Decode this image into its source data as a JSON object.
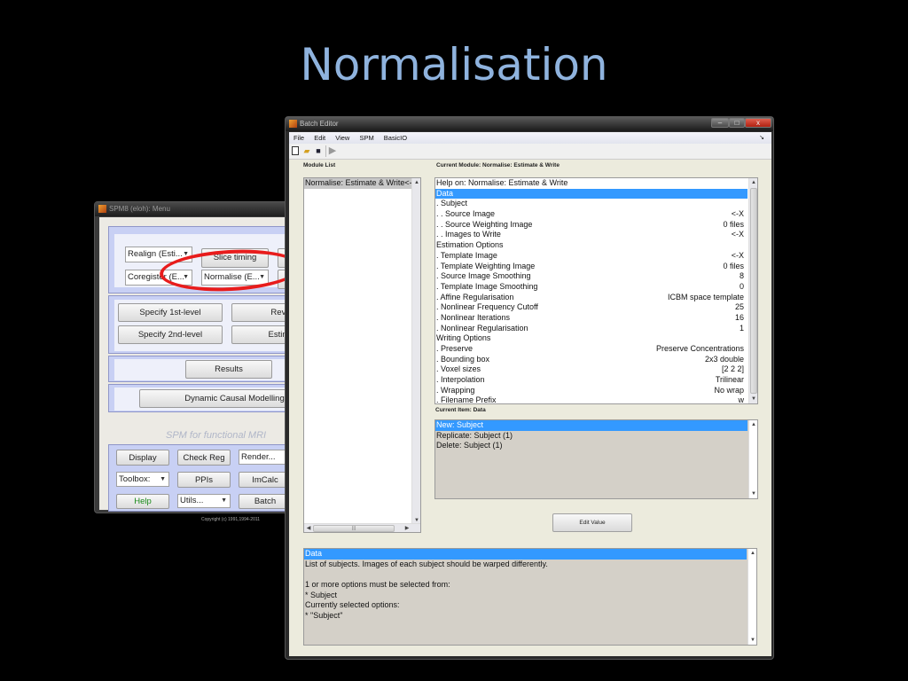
{
  "slide": {
    "title": "Normalisation"
  },
  "spm_menu": {
    "window_title": "SPM8 (eloh): Menu",
    "spatial": {
      "realign": "Realign (Esti...",
      "slice_timing": "Slice timing",
      "coregister": "Coregister (E...",
      "normalise": "Normalise (E..."
    },
    "model": {
      "specify_1st": "Specify 1st-level",
      "review": "Review",
      "specify_2nd": "Specify 2nd-level",
      "estimate": "Estimate"
    },
    "results": "Results",
    "dcm": "Dynamic Causal Modelling",
    "caption": "SPM for functional MRI",
    "tools": {
      "display": "Display",
      "check_reg": "Check Reg",
      "render": "Render...",
      "toolbox": "Toolbox:",
      "ppis": "PPIs",
      "imcalc": "ImCalc",
      "help": "Help",
      "utils": "Utils...",
      "batch": "Batch"
    },
    "copyright": "Copyright (c) 1991,1994-2011"
  },
  "annotation": {
    "color": "#e81c1c",
    "target": "Normalise (E..."
  },
  "batch_editor": {
    "window_title": "Batch Editor",
    "window_controls": {
      "minimize": "–",
      "maximize": "□",
      "close": "x"
    },
    "menu": [
      "File",
      "Edit",
      "View",
      "SPM",
      "BasicIO"
    ],
    "toolbar": [
      "new-file",
      "open-folder",
      "save",
      "run"
    ],
    "module_list_label": "Module List",
    "module_list": [
      "Normalise: Estimate & Write<-"
    ],
    "current_module_label": "Current Module: Normalise: Estimate & Write",
    "module_rows": [
      {
        "label": "Help on: Normalise: Estimate & Write",
        "value": ""
      },
      {
        "label": "Data",
        "value": "",
        "selected": true
      },
      {
        "label": ". Subject",
        "value": ""
      },
      {
        "label": ". . Source Image",
        "value": "<-X"
      },
      {
        "label": ". . Source Weighting Image",
        "value": "0 files"
      },
      {
        "label": ". . Images to Write",
        "value": "<-X"
      },
      {
        "label": "Estimation Options",
        "value": ""
      },
      {
        "label": ". Template Image",
        "value": "<-X"
      },
      {
        "label": ". Template Weighting Image",
        "value": "0 files"
      },
      {
        "label": ". Source Image Smoothing",
        "value": "8"
      },
      {
        "label": ". Template Image Smoothing",
        "value": "0"
      },
      {
        "label": ". Affine Regularisation",
        "value": "ICBM space template"
      },
      {
        "label": ". Nonlinear Frequency Cutoff",
        "value": "25"
      },
      {
        "label": ". Nonlinear Iterations",
        "value": "16"
      },
      {
        "label": ". Nonlinear Regularisation",
        "value": "1"
      },
      {
        "label": "Writing Options",
        "value": ""
      },
      {
        "label": ". Preserve",
        "value": "Preserve Concentrations"
      },
      {
        "label": ". Bounding box",
        "value": "2x3 double"
      },
      {
        "label": ". Voxel sizes",
        "value": "[2 2 2]"
      },
      {
        "label": ". Interpolation",
        "value": "Trilinear"
      },
      {
        "label": ". Wrapping",
        "value": "No wrap"
      },
      {
        "label": ". Filename Prefix",
        "value": "w"
      }
    ],
    "current_item_label": "Current Item: Data",
    "item_actions": [
      {
        "label": "New: Subject",
        "selected": true
      },
      {
        "label": "Replicate: Subject (1)"
      },
      {
        "label": "Delete: Subject (1)"
      }
    ],
    "edit_value": "Edit Value",
    "help_lines": [
      {
        "text": "Data",
        "selected": true
      },
      {
        "text": "List of subjects. Images of each subject should be warped differently."
      },
      {
        "text": ""
      },
      {
        "text": "1 or more options must be selected from:"
      },
      {
        "text": "* Subject"
      },
      {
        "text": "Currently selected options:"
      },
      {
        "text": "* \"Subject\""
      }
    ],
    "colors": {
      "selection": "#3399ff",
      "panel": "#ecebdd"
    }
  }
}
